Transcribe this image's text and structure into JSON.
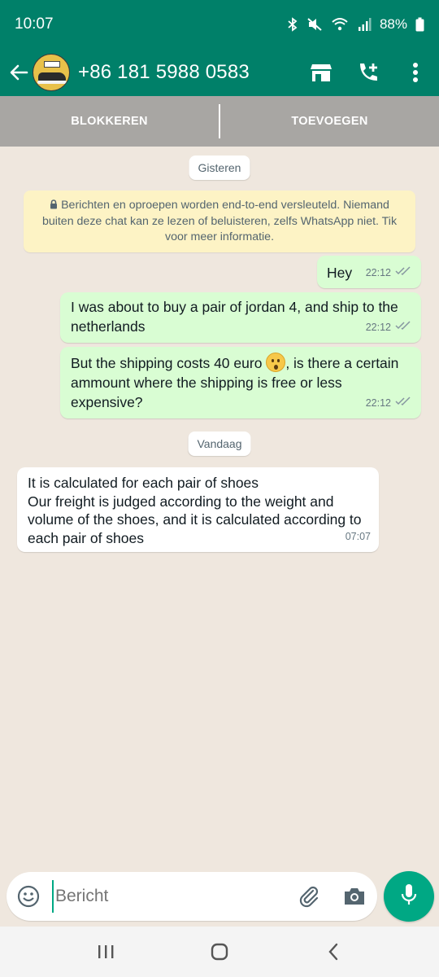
{
  "status_bar": {
    "time": "10:07",
    "battery": "88%"
  },
  "header": {
    "contact": "+86 181 5988 0583"
  },
  "actions": {
    "block": "BLOKKEREN",
    "add": "TOEVOEGEN"
  },
  "chat": {
    "date_yesterday": "Gisteren",
    "encryption_notice": "Berichten en oproepen worden end-to-end versleuteld. Niemand buiten deze chat kan ze lezen of beluisteren, zelfs WhatsApp niet. Tik voor meer informatie.",
    "messages": [
      {
        "text": "Hey",
        "time": "22:12"
      },
      {
        "text": "I was about to buy a pair of jordan 4, and ship to the netherlands",
        "time": "22:12"
      },
      {
        "text_before": "But the shipping costs 40 euro",
        "text_after": ", is there a certain ammount where the shipping is free or less expensive?",
        "time": "22:12"
      }
    ],
    "date_today": "Vandaag",
    "incoming": {
      "line1": "It is calculated for each pair of shoes",
      "line2": "Our freight is judged according to the weight and volume of the shoes, and it is calculated according to each pair of shoes",
      "time": "07:07"
    }
  },
  "composer": {
    "placeholder": "Bericht"
  },
  "colors": {
    "primary": "#008069",
    "accent": "#00a884",
    "outgoing_bubble": "#d9fdd3",
    "chat_background": "#efe7de"
  }
}
